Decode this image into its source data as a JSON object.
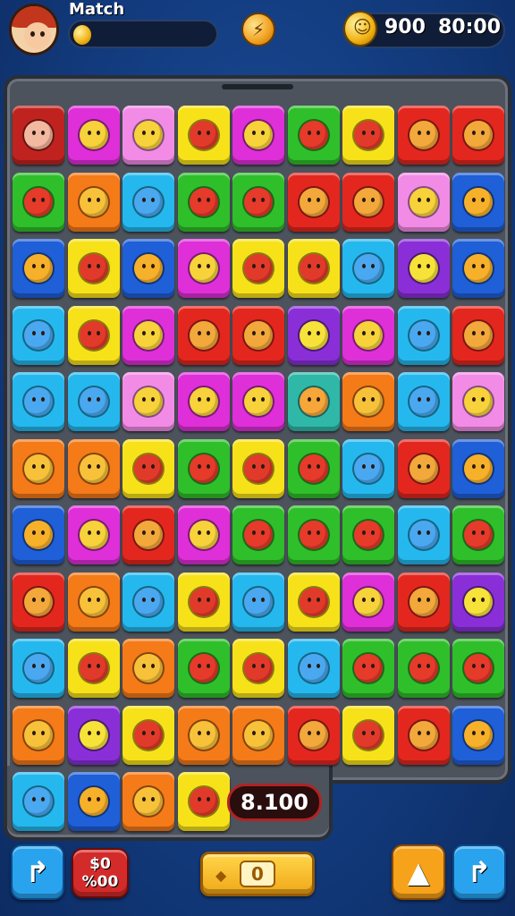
{
  "header": {
    "title": "Match",
    "level_progress": 0.0,
    "score_a": "900",
    "score_b": "80:00",
    "avatar_icon": "player-avatar",
    "coin_icon": "gold-coin",
    "center_icon": "booster-icon"
  },
  "board": {
    "rows": 11,
    "cols": 9,
    "tiles": [
      [
        "darkred",
        "magenta",
        "pink",
        "yellow",
        "magenta",
        "green",
        "yellow",
        "red",
        "red"
      ],
      [
        "green",
        "orange",
        "cyan",
        "green",
        "green",
        "red",
        "red",
        "pink",
        "blue"
      ],
      [
        "blue",
        "yellow",
        "blue",
        "magenta",
        "yellow",
        "yellow",
        "cyan",
        "purple",
        "blue"
      ],
      [
        "cyan",
        "yellow",
        "magenta",
        "red",
        "red",
        "purple",
        "magenta",
        "cyan",
        "red"
      ],
      [
        "cyan",
        "cyan",
        "pink",
        "magenta",
        "magenta",
        "teal",
        "orange",
        "cyan",
        "pink"
      ],
      [
        "orange",
        "orange",
        "yellow",
        "green",
        "yellow",
        "green",
        "cyan",
        "red",
        "blue"
      ],
      [
        "blue",
        "magenta",
        "red",
        "magenta",
        "green",
        "green",
        "green",
        "cyan",
        "green"
      ],
      [
        "red",
        "orange",
        "cyan",
        "yellow",
        "cyan",
        "yellow",
        "magenta",
        "red",
        "purple"
      ],
      [
        "cyan",
        "yellow",
        "orange",
        "green",
        "yellow",
        "cyan",
        "green",
        "green",
        "green"
      ],
      [
        "orange",
        "purple",
        "yellow",
        "orange",
        "orange",
        "red",
        "yellow",
        "red",
        "blue"
      ],
      [
        "cyan",
        "blue",
        "orange",
        "yellow"
      ]
    ]
  },
  "palette": {
    "darkred": "#c0231f",
    "magenta": "#df2fd8",
    "pink": "#f28be6",
    "yellow": "#f7e21a",
    "green": "#2fbf2a",
    "red": "#e3271f",
    "orange": "#f57a18",
    "cyan": "#25b8ee",
    "blue": "#1f5fd8",
    "purple": "#8a2fd8",
    "teal": "#2fb8a8"
  },
  "bottom": {
    "board_score": "8.100",
    "red_button_top": "$0",
    "red_button_bottom": "%00",
    "gold_button_value": "0",
    "left_button_icon": "undo-arrow-icon",
    "right_button_icon": "redo-arrow-icon",
    "orange_button_icon": "hint-arrow-icon"
  }
}
